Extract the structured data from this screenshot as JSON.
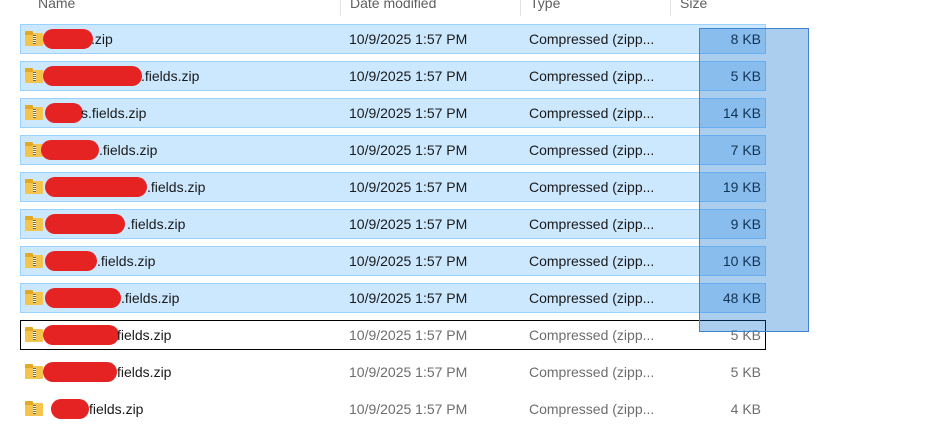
{
  "columns": [
    {
      "key": "name",
      "label": "Name"
    },
    {
      "key": "date",
      "label": "Date modified"
    },
    {
      "key": "type",
      "label": "Type"
    },
    {
      "key": "size",
      "label": "Size"
    }
  ],
  "rows": [
    {
      "name": ".zip",
      "date": "10/9/2025 1:57 PM",
      "type": "Compressed (zipp...",
      "size": "8 KB",
      "selected": true
    },
    {
      "name": ".fields.zip",
      "date": "10/9/2025 1:57 PM",
      "type": "Compressed (zipp...",
      "size": "5 KB",
      "selected": true
    },
    {
      "name": "s.fields.zip",
      "date": "10/9/2025 1:57 PM",
      "type": "Compressed (zipp...",
      "size": "14 KB",
      "selected": true
    },
    {
      "name": ".fields.zip",
      "date": "10/9/2025 1:57 PM",
      "type": "Compressed (zipp...",
      "size": "7 KB",
      "selected": true
    },
    {
      "name": ".fields.zip",
      "date": "10/9/2025 1:57 PM",
      "type": "Compressed (zipp...",
      "size": "19 KB",
      "selected": true
    },
    {
      "name": ".fields.zip",
      "date": "10/9/2025 1:57 PM",
      "type": "Compressed (zipp...",
      "size": "9 KB",
      "selected": true
    },
    {
      "name": ".fields.zip",
      "date": "10/9/2025 1:57 PM",
      "type": "Compressed (zipp...",
      "size": "10 KB",
      "selected": true
    },
    {
      "name": ".fields.zip",
      "date": "10/9/2025 1:57 PM",
      "type": "Compressed (zipp...",
      "size": "48 KB",
      "selected": true
    },
    {
      "name": "fields.zip",
      "date": "10/9/2025 1:57 PM",
      "type": "Compressed (zipp...",
      "size": "5 KB",
      "selected": false,
      "focused": true
    },
    {
      "name": "fields.zip",
      "date": "10/9/2025 1:57 PM",
      "type": "Compressed (zipp...",
      "size": "5 KB",
      "selected": false
    },
    {
      "name": "fields.zip",
      "date": "10/9/2025 1:57 PM",
      "type": "Compressed (zipp...",
      "size": "4 KB",
      "selected": false
    }
  ],
  "colors": {
    "selection_bg": "#cce8ff",
    "selection_border": "#99d1ff",
    "marquee": "#3d84d1",
    "redaction": "#e52323",
    "zip_folder": "#f3c44e"
  }
}
